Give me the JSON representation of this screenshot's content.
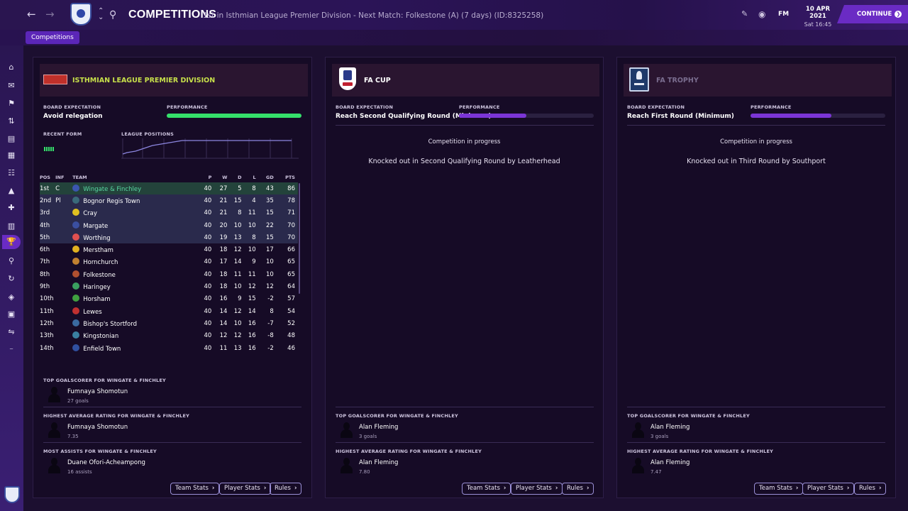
{
  "header": {
    "title": "COMPETITIONS",
    "subtitle": "1st in Isthmian League Premier Division - Next Match: Folkestone (A) (7 days) (ID:8325258)",
    "fm_label": "FM",
    "date": "10 APR 2021",
    "time": "Sat 16:45",
    "continue_label": "CONTINUE"
  },
  "breadcrumb": "Competitions",
  "sidebar": {
    "icons": [
      "home-icon",
      "inbox-icon",
      "squad-icon",
      "tactics-icon",
      "data-hub-icon",
      "reports-icon",
      "staff-icon",
      "training-icon",
      "medical-icon",
      "schedule-icon",
      "competitions-icon",
      "scouting-icon",
      "transfers-icon",
      "club-info-icon",
      "finances-icon",
      "dev-centre-icon",
      "scroll-icon"
    ]
  },
  "league": {
    "name": "ISTHMIAN LEAGUE PREMIER DIVISION",
    "board_expectation_label": "BOARD EXPECTATION",
    "board_expectation": "Avoid relegation",
    "performance_label": "PERFORMANCE",
    "performance": 1.0,
    "recent_form_label": "RECENT FORM",
    "league_positions_label": "LEAGUE POSITIONS",
    "columns": [
      "POS",
      "INF",
      "TEAM",
      "P",
      "W",
      "D",
      "L",
      "GD",
      "PTS"
    ],
    "rows": [
      {
        "pos": "1st",
        "inf": "C",
        "team": "Wingate & Finchley",
        "p": "40",
        "w": "27",
        "d": "5",
        "l": "8",
        "gd": "43",
        "pts": "86"
      },
      {
        "pos": "2nd",
        "inf": "Pl",
        "team": "Bognor Regis Town",
        "p": "40",
        "w": "21",
        "d": "15",
        "l": "4",
        "gd": "35",
        "pts": "78"
      },
      {
        "pos": "3rd",
        "inf": "",
        "team": "Cray",
        "p": "40",
        "w": "21",
        "d": "8",
        "l": "11",
        "gd": "15",
        "pts": "71"
      },
      {
        "pos": "4th",
        "inf": "",
        "team": "Margate",
        "p": "40",
        "w": "20",
        "d": "10",
        "l": "10",
        "gd": "22",
        "pts": "70"
      },
      {
        "pos": "5th",
        "inf": "",
        "team": "Worthing",
        "p": "40",
        "w": "19",
        "d": "13",
        "l": "8",
        "gd": "15",
        "pts": "70"
      },
      {
        "pos": "6th",
        "inf": "",
        "team": "Merstham",
        "p": "40",
        "w": "18",
        "d": "12",
        "l": "10",
        "gd": "17",
        "pts": "66"
      },
      {
        "pos": "7th",
        "inf": "",
        "team": "Hornchurch",
        "p": "40",
        "w": "17",
        "d": "14",
        "l": "9",
        "gd": "10",
        "pts": "65"
      },
      {
        "pos": "8th",
        "inf": "",
        "team": "Folkestone",
        "p": "40",
        "w": "18",
        "d": "11",
        "l": "11",
        "gd": "10",
        "pts": "65"
      },
      {
        "pos": "9th",
        "inf": "",
        "team": "Haringey",
        "p": "40",
        "w": "18",
        "d": "10",
        "l": "12",
        "gd": "12",
        "pts": "64"
      },
      {
        "pos": "10th",
        "inf": "",
        "team": "Horsham",
        "p": "40",
        "w": "16",
        "d": "9",
        "l": "15",
        "gd": "-2",
        "pts": "57"
      },
      {
        "pos": "11th",
        "inf": "",
        "team": "Lewes",
        "p": "40",
        "w": "14",
        "d": "12",
        "l": "14",
        "gd": "8",
        "pts": "54"
      },
      {
        "pos": "12th",
        "inf": "",
        "team": "Bishop's Stortford",
        "p": "40",
        "w": "14",
        "d": "10",
        "l": "16",
        "gd": "-7",
        "pts": "52"
      },
      {
        "pos": "13th",
        "inf": "",
        "team": "Kingstonian",
        "p": "40",
        "w": "12",
        "d": "12",
        "l": "16",
        "gd": "-8",
        "pts": "48"
      },
      {
        "pos": "14th",
        "inf": "",
        "team": "Enfield Town",
        "p": "40",
        "w": "11",
        "d": "13",
        "l": "16",
        "gd": "-2",
        "pts": "46"
      }
    ],
    "badge_colors": [
      "#3b55b0",
      "#3a6a7a",
      "#e0c020",
      "#3b4fa0",
      "#e05050",
      "#e0b020",
      "#c08030",
      "#b05030",
      "#3aa060",
      "#40a040",
      "#c03030",
      "#3a6aa0",
      "#3a80a0",
      "#3050a0"
    ],
    "top_scorer_label": "TOP GOALSCORER FOR WINGATE & FINCHLEY",
    "top_scorer": {
      "name": "Fumnaya Shomotun",
      "value": "27 goals"
    },
    "top_rating_label": "HIGHEST AVERAGE RATING FOR WINGATE & FINCHLEY",
    "top_rating": {
      "name": "Fumnaya Shomotun",
      "value": "7.35"
    },
    "top_assists_label": "MOST ASSISTS FOR WINGATE & FINCHLEY",
    "top_assists": {
      "name": "Duane Ofori-Acheampong",
      "value": "16 assists"
    }
  },
  "fa_cup": {
    "name": "FA CUP",
    "board_expectation_label": "BOARD EXPECTATION",
    "board_expectation": "Reach Second Qualifying Round (Minimum)",
    "performance_label": "PERFORMANCE",
    "performance": 0.5,
    "status": "Competition in progress",
    "result": "Knocked out in Second Qualifying Round by Leatherhead",
    "top_scorer_label": "TOP GOALSCORER FOR WINGATE & FINCHLEY",
    "top_scorer": {
      "name": "Alan Fleming",
      "value": "3 goals"
    },
    "top_rating_label": "HIGHEST AVERAGE RATING FOR WINGATE & FINCHLEY",
    "top_rating": {
      "name": "Alan Fleming",
      "value": "7.80"
    }
  },
  "fa_trophy": {
    "name": "FA TROPHY",
    "board_expectation_label": "BOARD EXPECTATION",
    "board_expectation": "Reach First Round (Minimum)",
    "performance_label": "PERFORMANCE",
    "performance": 0.6,
    "status": "Competition in progress",
    "result": "Knocked out in Third Round by Southport",
    "top_scorer_label": "TOP GOALSCORER FOR WINGATE & FINCHLEY",
    "top_scorer": {
      "name": "Alan Fleming",
      "value": "3 goals"
    },
    "top_rating_label": "HIGHEST AVERAGE RATING FOR WINGATE & FINCHLEY",
    "top_rating": {
      "name": "Alan Fleming",
      "value": "7.47"
    }
  },
  "buttons": {
    "team_stats": "Team Stats",
    "player_stats": "Player Stats",
    "rules": "Rules"
  },
  "colors": {
    "accent": "#6a2bc4",
    "performance_full": "#35e06b",
    "performance_partial": "#7b35d6",
    "league_name": "#c7e04a"
  }
}
